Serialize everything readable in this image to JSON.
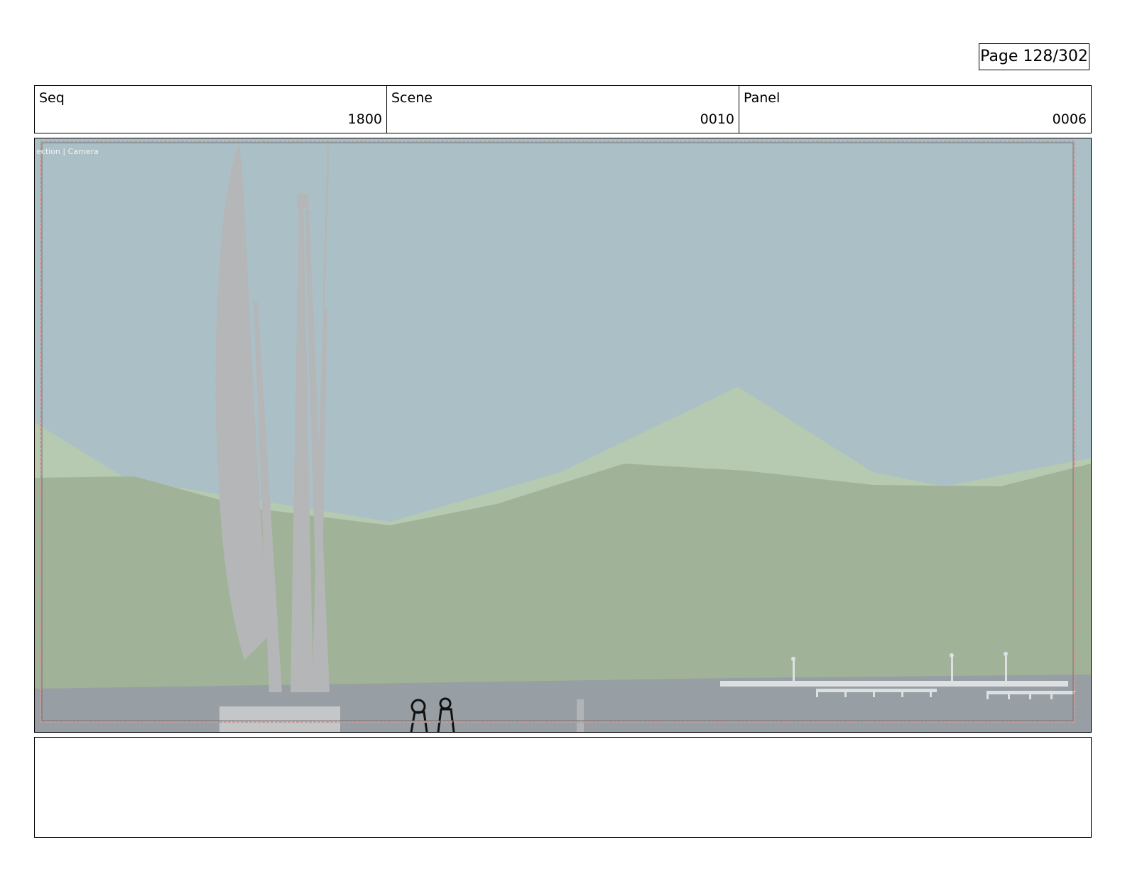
{
  "page": {
    "label": "Page 128/302"
  },
  "header": {
    "seq": {
      "label": "Seq",
      "value": "1800"
    },
    "scene": {
      "label": "Scene",
      "value": "0010"
    },
    "panel": {
      "label": "Panel",
      "value": "0006"
    }
  },
  "viewport": {
    "overlay_text": "ection | Camera",
    "colors": {
      "sky": "#abc0c6",
      "far_mountain": "#b6c9b1",
      "near_hills": "#a0b398",
      "water": "#989fa4",
      "sculpture": "#b4b6b8",
      "frame_border": "#c79a94"
    }
  },
  "notes": {
    "text": ""
  }
}
